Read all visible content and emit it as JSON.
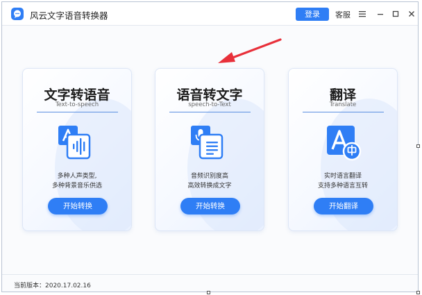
{
  "app": {
    "title": "风云文字语音转换器",
    "icon": "chat-bubble-icon"
  },
  "header": {
    "login_label": "登录",
    "service_label": "客服"
  },
  "window_controls": [
    "menu-icon",
    "minimize-icon",
    "maximize-icon",
    "close-icon"
  ],
  "cards": [
    {
      "title": "文字转语音",
      "subtitle": "Text-to-speech",
      "icon": "text-to-speech-icon",
      "desc": [
        "多种人声类型,",
        "多种背景音乐供选"
      ],
      "button": "开始转换"
    },
    {
      "title": "语音转文字",
      "subtitle": "speech-to-Text",
      "icon": "speech-to-text-icon",
      "desc": [
        "音频识别度高",
        "高效转换成文字"
      ],
      "button": "开始转换"
    },
    {
      "title": "翻译",
      "subtitle": "Translate",
      "icon": "translate-icon",
      "desc": [
        "实时语言翻译",
        "支持多种语言互转"
      ],
      "button": "开始翻译"
    }
  ],
  "footer": {
    "version": "当前版本：2020.17.02.16"
  },
  "colors": {
    "accent": "#2f7ef5",
    "annotation_arrow": "#e8303a"
  }
}
